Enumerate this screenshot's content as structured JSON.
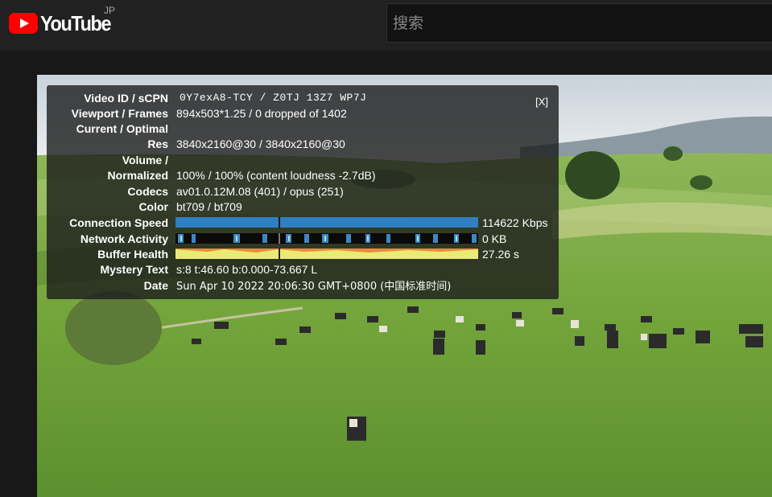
{
  "masthead": {
    "logo_text": "YouTube",
    "country_code": "JP",
    "search_placeholder": "搜索"
  },
  "stats": {
    "close_label": "[X]",
    "video_id_label": "Video ID / sCPN",
    "video_id_value": "0Y7exA8-TCY / Z0TJ 13Z7 WP7J",
    "viewport_label": "Viewport / Frames",
    "viewport_value": "894x503*1.25 / 0 dropped of 1402",
    "current_optimal_label": "Current / Optimal",
    "res_label": "Res",
    "res_value": "3840x2160@30 / 3840x2160@30",
    "volume_label": "Volume /",
    "normalized_label": "Normalized",
    "volume_value": "100% / 100% (content loudness -2.7dB)",
    "codecs_label": "Codecs",
    "codecs_value": "av01.0.12M.08 (401) / opus (251)",
    "color_label": "Color",
    "color_value": "bt709 / bt709",
    "connection_label": "Connection Speed",
    "connection_value": "114622 Kbps",
    "network_label": "Network Activity",
    "network_value": "0 KB",
    "buffer_label": "Buffer Health",
    "buffer_value": "27.26 s",
    "mystery_label": "Mystery Text",
    "mystery_value": "s:8 t:46.60 b:0.000-73.667 L",
    "date_label": "Date",
    "date_value": "Sun Apr 10 2022 20:06:30 GMT+0800 (中国标准时间)"
  },
  "colors": {
    "brand_red": "#ff0000",
    "connection_bar": "#2f7fc1",
    "buffer_bar": "#eaeb73",
    "buffer_marker": "#e87a3a"
  }
}
